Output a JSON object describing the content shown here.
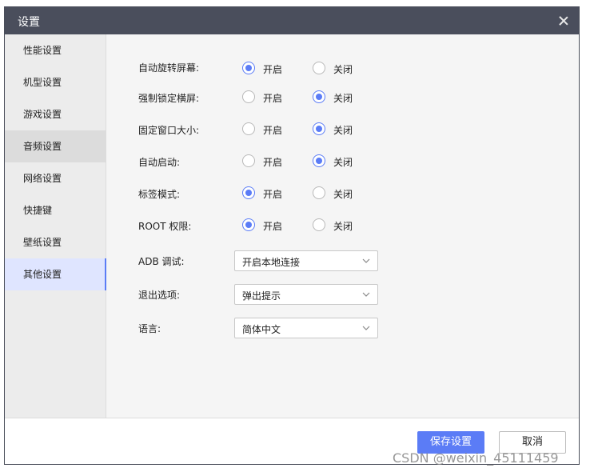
{
  "window": {
    "title": "设置"
  },
  "sidebar": {
    "items": [
      {
        "label": "性能设置"
      },
      {
        "label": "机型设置"
      },
      {
        "label": "游戏设置"
      },
      {
        "label": "音频设置"
      },
      {
        "label": "网络设置"
      },
      {
        "label": "快捷键"
      },
      {
        "label": "壁纸设置"
      },
      {
        "label": "其他设置"
      }
    ],
    "active_index": 7,
    "hover_index": 3
  },
  "options": {
    "on_label": "开启",
    "off_label": "关闭",
    "rows": [
      {
        "label": "自动旋转屏幕:",
        "value": "开启"
      },
      {
        "label": "强制锁定横屏:",
        "value": "关闭"
      },
      {
        "label": "固定窗口大小:",
        "value": "关闭"
      },
      {
        "label": "自动启动:",
        "value": "关闭"
      },
      {
        "label": "标签模式:",
        "value": "开启"
      },
      {
        "label": "ROOT 权限:",
        "value": "开启"
      }
    ]
  },
  "selects": [
    {
      "label": "ADB 调试:",
      "value": "开启本地连接"
    },
    {
      "label": "退出选项:",
      "value": "弹出提示"
    },
    {
      "label": "语言:",
      "value": "简体中文"
    }
  ],
  "footer": {
    "save_label": "保存设置",
    "cancel_label": "取消"
  },
  "watermark": "CSDN @weixin_45111459",
  "colors": {
    "accent": "#5b7cf6",
    "titlebar": "#4a4e5c",
    "panel": "#f5f5f5",
    "sidebar": "#ececec"
  },
  "icons": {
    "close": "close-icon",
    "chevron": "chevron-down-icon"
  }
}
